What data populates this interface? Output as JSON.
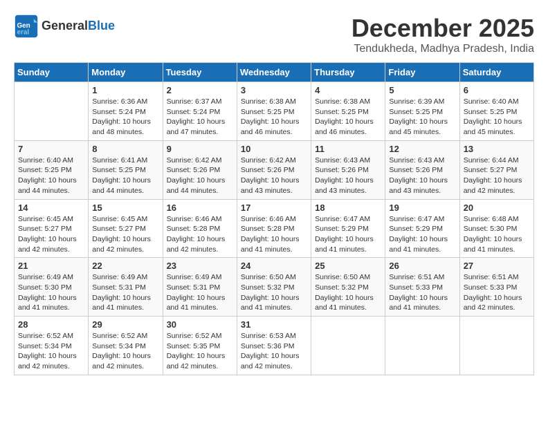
{
  "logo": {
    "general": "General",
    "blue": "Blue"
  },
  "header": {
    "title": "December 2025",
    "location": "Tendukheda, Madhya Pradesh, India"
  },
  "weekdays": [
    "Sunday",
    "Monday",
    "Tuesday",
    "Wednesday",
    "Thursday",
    "Friday",
    "Saturday"
  ],
  "weeks": [
    [
      {
        "day": "",
        "sunrise": "",
        "sunset": "",
        "daylight": ""
      },
      {
        "day": "1",
        "sunrise": "Sunrise: 6:36 AM",
        "sunset": "Sunset: 5:24 PM",
        "daylight": "Daylight: 10 hours and 48 minutes."
      },
      {
        "day": "2",
        "sunrise": "Sunrise: 6:37 AM",
        "sunset": "Sunset: 5:24 PM",
        "daylight": "Daylight: 10 hours and 47 minutes."
      },
      {
        "day": "3",
        "sunrise": "Sunrise: 6:38 AM",
        "sunset": "Sunset: 5:25 PM",
        "daylight": "Daylight: 10 hours and 46 minutes."
      },
      {
        "day": "4",
        "sunrise": "Sunrise: 6:38 AM",
        "sunset": "Sunset: 5:25 PM",
        "daylight": "Daylight: 10 hours and 46 minutes."
      },
      {
        "day": "5",
        "sunrise": "Sunrise: 6:39 AM",
        "sunset": "Sunset: 5:25 PM",
        "daylight": "Daylight: 10 hours and 45 minutes."
      },
      {
        "day": "6",
        "sunrise": "Sunrise: 6:40 AM",
        "sunset": "Sunset: 5:25 PM",
        "daylight": "Daylight: 10 hours and 45 minutes."
      }
    ],
    [
      {
        "day": "7",
        "sunrise": "Sunrise: 6:40 AM",
        "sunset": "Sunset: 5:25 PM",
        "daylight": "Daylight: 10 hours and 44 minutes."
      },
      {
        "day": "8",
        "sunrise": "Sunrise: 6:41 AM",
        "sunset": "Sunset: 5:25 PM",
        "daylight": "Daylight: 10 hours and 44 minutes."
      },
      {
        "day": "9",
        "sunrise": "Sunrise: 6:42 AM",
        "sunset": "Sunset: 5:26 PM",
        "daylight": "Daylight: 10 hours and 44 minutes."
      },
      {
        "day": "10",
        "sunrise": "Sunrise: 6:42 AM",
        "sunset": "Sunset: 5:26 PM",
        "daylight": "Daylight: 10 hours and 43 minutes."
      },
      {
        "day": "11",
        "sunrise": "Sunrise: 6:43 AM",
        "sunset": "Sunset: 5:26 PM",
        "daylight": "Daylight: 10 hours and 43 minutes."
      },
      {
        "day": "12",
        "sunrise": "Sunrise: 6:43 AM",
        "sunset": "Sunset: 5:26 PM",
        "daylight": "Daylight: 10 hours and 43 minutes."
      },
      {
        "day": "13",
        "sunrise": "Sunrise: 6:44 AM",
        "sunset": "Sunset: 5:27 PM",
        "daylight": "Daylight: 10 hours and 42 minutes."
      }
    ],
    [
      {
        "day": "14",
        "sunrise": "Sunrise: 6:45 AM",
        "sunset": "Sunset: 5:27 PM",
        "daylight": "Daylight: 10 hours and 42 minutes."
      },
      {
        "day": "15",
        "sunrise": "Sunrise: 6:45 AM",
        "sunset": "Sunset: 5:27 PM",
        "daylight": "Daylight: 10 hours and 42 minutes."
      },
      {
        "day": "16",
        "sunrise": "Sunrise: 6:46 AM",
        "sunset": "Sunset: 5:28 PM",
        "daylight": "Daylight: 10 hours and 42 minutes."
      },
      {
        "day": "17",
        "sunrise": "Sunrise: 6:46 AM",
        "sunset": "Sunset: 5:28 PM",
        "daylight": "Daylight: 10 hours and 41 minutes."
      },
      {
        "day": "18",
        "sunrise": "Sunrise: 6:47 AM",
        "sunset": "Sunset: 5:29 PM",
        "daylight": "Daylight: 10 hours and 41 minutes."
      },
      {
        "day": "19",
        "sunrise": "Sunrise: 6:47 AM",
        "sunset": "Sunset: 5:29 PM",
        "daylight": "Daylight: 10 hours and 41 minutes."
      },
      {
        "day": "20",
        "sunrise": "Sunrise: 6:48 AM",
        "sunset": "Sunset: 5:30 PM",
        "daylight": "Daylight: 10 hours and 41 minutes."
      }
    ],
    [
      {
        "day": "21",
        "sunrise": "Sunrise: 6:49 AM",
        "sunset": "Sunset: 5:30 PM",
        "daylight": "Daylight: 10 hours and 41 minutes."
      },
      {
        "day": "22",
        "sunrise": "Sunrise: 6:49 AM",
        "sunset": "Sunset: 5:31 PM",
        "daylight": "Daylight: 10 hours and 41 minutes."
      },
      {
        "day": "23",
        "sunrise": "Sunrise: 6:49 AM",
        "sunset": "Sunset: 5:31 PM",
        "daylight": "Daylight: 10 hours and 41 minutes."
      },
      {
        "day": "24",
        "sunrise": "Sunrise: 6:50 AM",
        "sunset": "Sunset: 5:32 PM",
        "daylight": "Daylight: 10 hours and 41 minutes."
      },
      {
        "day": "25",
        "sunrise": "Sunrise: 6:50 AM",
        "sunset": "Sunset: 5:32 PM",
        "daylight": "Daylight: 10 hours and 41 minutes."
      },
      {
        "day": "26",
        "sunrise": "Sunrise: 6:51 AM",
        "sunset": "Sunset: 5:33 PM",
        "daylight": "Daylight: 10 hours and 41 minutes."
      },
      {
        "day": "27",
        "sunrise": "Sunrise: 6:51 AM",
        "sunset": "Sunset: 5:33 PM",
        "daylight": "Daylight: 10 hours and 42 minutes."
      }
    ],
    [
      {
        "day": "28",
        "sunrise": "Sunrise: 6:52 AM",
        "sunset": "Sunset: 5:34 PM",
        "daylight": "Daylight: 10 hours and 42 minutes."
      },
      {
        "day": "29",
        "sunrise": "Sunrise: 6:52 AM",
        "sunset": "Sunset: 5:34 PM",
        "daylight": "Daylight: 10 hours and 42 minutes."
      },
      {
        "day": "30",
        "sunrise": "Sunrise: 6:52 AM",
        "sunset": "Sunset: 5:35 PM",
        "daylight": "Daylight: 10 hours and 42 minutes."
      },
      {
        "day": "31",
        "sunrise": "Sunrise: 6:53 AM",
        "sunset": "Sunset: 5:36 PM",
        "daylight": "Daylight: 10 hours and 42 minutes."
      },
      {
        "day": "",
        "sunrise": "",
        "sunset": "",
        "daylight": ""
      },
      {
        "day": "",
        "sunrise": "",
        "sunset": "",
        "daylight": ""
      },
      {
        "day": "",
        "sunrise": "",
        "sunset": "",
        "daylight": ""
      }
    ]
  ]
}
